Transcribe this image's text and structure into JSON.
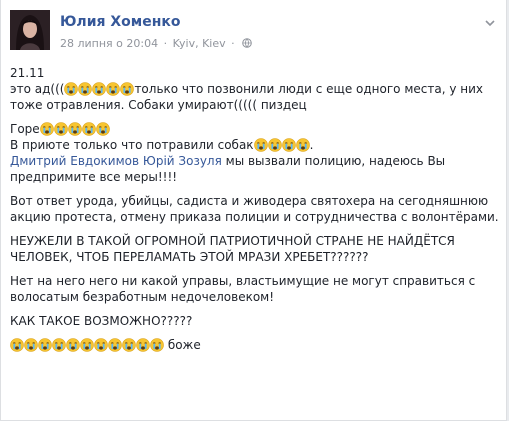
{
  "post": {
    "author": "Юлия Хоменко",
    "date": "28 липня о 20:04",
    "location": "Kyiv, Kiev",
    "separator": "·",
    "icons": {
      "privacy": "globe-icon",
      "options": "chevron-down-icon",
      "emoji": "loudly-crying-face-emoji"
    },
    "lines": {
      "l1": "21.11",
      "l2a": "это ад(((",
      "l2b": "только что позвонили люди с еще одного места, у них тоже отравления. Собаки умирают((((( пиздец",
      "l3a": "Горе",
      "l3b": "В приюте только что потравили собак",
      "l3c_link1": "Дмитрий Евдокимов",
      "l3c_link2": "Юрій Зозуля",
      "l3c_rest": " мы вызвали полицию, надеюсь Вы предпримите все меры!!!!",
      "l4": "Вот ответ урода, убийцы, садиста и живодера святохера на сегодняшнюю акцию протеста, отмену приказа полиции и сотрудничества с волонтёрами.",
      "l5": "НЕУЖЕЛИ В ТАКОЙ ОГРОМНОЙ ПАТРИОТИЧНОЙ СТРАНЕ НЕ НАЙДЁТСЯ ЧЕЛОВЕК, ЧТОБ ПЕРЕЛАМАТЬ ЭТОЙ МРАЗИ ХРЕБЕТ??????",
      "l6": "Нет на него него ни какой управы, властьимущие не могут справиться с волосатым безработным недочеловеком!",
      "l7": "КАК ТАКОЕ ВОЗМОЖНО?????",
      "l8": " боже"
    },
    "colors": {
      "link": "#365899",
      "text": "#1d2129",
      "meta": "#90949c",
      "emoji": "#f7c531"
    }
  }
}
